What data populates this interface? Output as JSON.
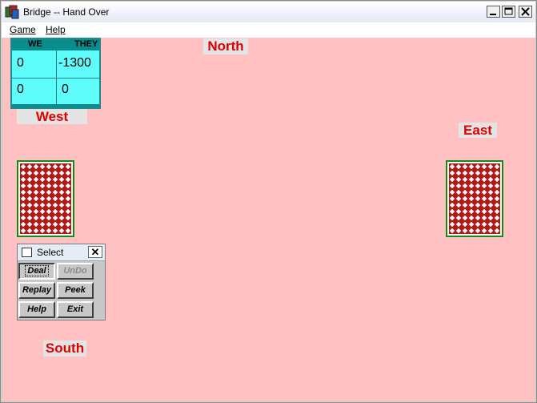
{
  "window": {
    "title": "Bridge -- Hand Over"
  },
  "menu": {
    "items": [
      {
        "label": "Game"
      },
      {
        "label": "Help"
      }
    ]
  },
  "seats": {
    "north": "North",
    "west": "West",
    "east": "East",
    "south": "South"
  },
  "score": {
    "headers": [
      "WE",
      "THEY"
    ],
    "rows": [
      [
        "0",
        "-1300"
      ],
      [
        "0",
        "0"
      ]
    ]
  },
  "palette": {
    "title": "Select",
    "close_label": "✕",
    "buttons": [
      {
        "label": "Deal"
      },
      {
        "label": "UnDo"
      },
      {
        "label": "Replay"
      },
      {
        "label": "Peek"
      },
      {
        "label": "Help"
      },
      {
        "label": "Exit"
      }
    ]
  },
  "colors": {
    "table": "#ffc1c1",
    "seat_text": "#e00000",
    "score_bg": "#5ffcfc",
    "card_back": "#b01818",
    "card_border": "#138a13"
  },
  "icons": {
    "app": "bridge-app-icon",
    "minimize": "minimize-icon",
    "maximize": "maximize-icon",
    "close": "close-icon"
  }
}
